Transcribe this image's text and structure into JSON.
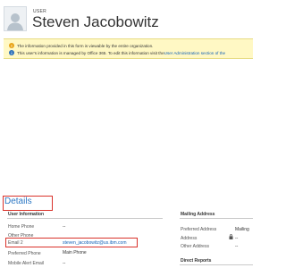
{
  "header": {
    "record_type": "USER",
    "record_name": "Steven Jacobowitz"
  },
  "notifications": [
    {
      "icon": "warning-icon",
      "text": "The information provided in this form is viewable by the entire organization."
    },
    {
      "icon": "info-icon",
      "text": "This user's information is managed by Office 365. To edit this information visit the ",
      "link": "User Administration section of the"
    }
  ],
  "details": {
    "title": "Details",
    "user_information": {
      "title": "User Information",
      "fields": [
        {
          "label": "Home Phone",
          "value": "--"
        },
        {
          "label": "Other Phone",
          "value": ""
        },
        {
          "label": "Email 2",
          "value": "steven_jacobowitz@us.ibm.com"
        },
        {
          "label": "Preferred Phone",
          "value": "Main Phone"
        },
        {
          "label": "Mobile Alert Email",
          "value": "--"
        }
      ]
    },
    "mailing_address": {
      "title": "Mailing Address",
      "fields": [
        {
          "label": "Preferred Address",
          "value": "Mailing"
        },
        {
          "label": "Address",
          "value": "--"
        },
        {
          "label": "Other Address",
          "value": "--"
        }
      ]
    },
    "direct_reports": {
      "title": "Direct Reports"
    }
  },
  "colors": {
    "accent": "#2d78c4",
    "highlight": "#d9322b",
    "notification_bg": "#fff8c4"
  }
}
